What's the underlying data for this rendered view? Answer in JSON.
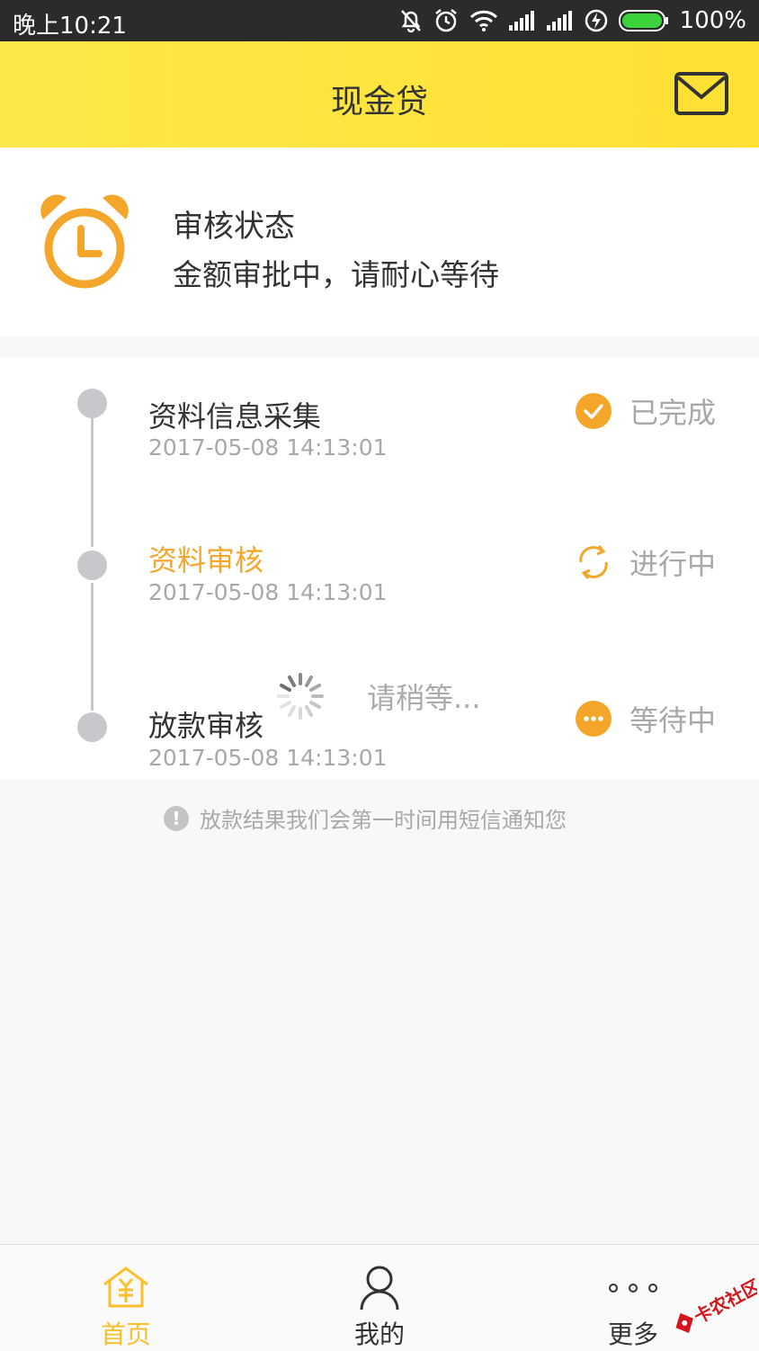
{
  "statusbar": {
    "time": "晚上10:21",
    "battery": "100%"
  },
  "header": {
    "title": "现金贷"
  },
  "status_card": {
    "heading": "审核状态",
    "message": "金额审批中，请耐心等待"
  },
  "steps": [
    {
      "title": "资料信息采集",
      "time": "2017-05-08 14:13:01",
      "status": "已完成",
      "state": "done"
    },
    {
      "title": "资料审核",
      "time": "2017-05-08 14:13:01",
      "status": "进行中",
      "state": "in-progress"
    },
    {
      "title": "放款审核",
      "time": "2017-05-08 14:13:01",
      "status": "等待中",
      "state": "waiting"
    }
  ],
  "loading": {
    "text": "请稍等..."
  },
  "notice": {
    "icon": "!",
    "text": "放款结果我们会第一时间用短信通知您"
  },
  "nav": [
    {
      "label": "首页",
      "icon": "home-icon",
      "active": true
    },
    {
      "label": "我的",
      "icon": "user-icon",
      "active": false
    },
    {
      "label": "更多",
      "icon": "more-icon",
      "active": false
    }
  ],
  "watermark": {
    "text": "卡农社区"
  },
  "colors": {
    "accent": "#f4a62a",
    "header": "#ffe033",
    "nav_active": "#fbc02d"
  }
}
